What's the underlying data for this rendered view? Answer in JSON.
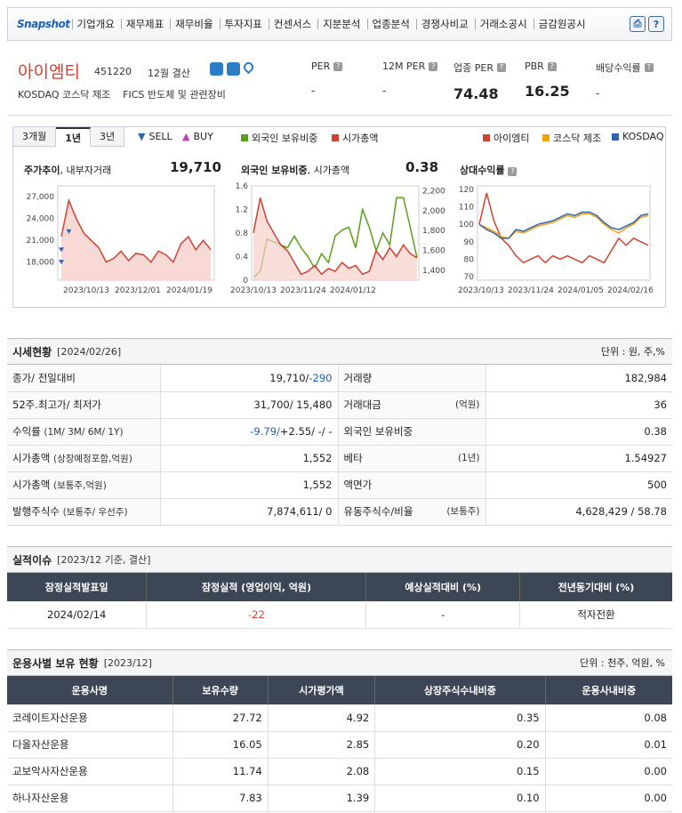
{
  "nav": {
    "snapshot": "Snapshot",
    "items": [
      "기업개요",
      "재무제표",
      "재무비율",
      "투자지표",
      "컨센서스",
      "지분분석",
      "업종분석",
      "경쟁사비교",
      "거래소공시",
      "금감원공시"
    ]
  },
  "company": {
    "name": "아이엠티",
    "code": "451220",
    "fiscal": "12월 결산",
    "market": "KOSDAQ  코스닥 제조",
    "fics": "FICS 반도체 및 관련장비"
  },
  "metrics": [
    {
      "label": "PER",
      "value": "-"
    },
    {
      "label": "12M PER",
      "value": "-"
    },
    {
      "label": "업종 PER",
      "value": "74.48"
    },
    {
      "label": "PBR",
      "value": "16.25"
    },
    {
      "label": "배당수익률",
      "value": "-"
    }
  ],
  "chart_tabs": [
    "3개월",
    "1년",
    "3년"
  ],
  "chart_legend": {
    "sell": "SELL",
    "buy": "BUY",
    "foreign": "외국인 보유비중",
    "mcap": "시가총액",
    "company": "아이엠티",
    "kosdaq_mfg": "코스닥 제조",
    "kosdaq": "KOSDAQ"
  },
  "chart_data": [
    {
      "type": "area",
      "title": "주가추이",
      "subtitle": ", 내부자거래",
      "value": "19,710",
      "x_labels": [
        "2023/10/13",
        "2023/12/01",
        "2024/01/19"
      ],
      "y_ticks": [
        "27,000",
        "24,000",
        "21,000",
        "18,000"
      ],
      "ylim": [
        15500,
        28500
      ],
      "values": [
        21500,
        26500,
        24000,
        22000,
        21000,
        20000,
        18000,
        18500,
        19500,
        18200,
        19200,
        19000,
        18000,
        19500,
        19000,
        18000,
        20500,
        21500,
        19700,
        21000,
        19710
      ],
      "color": "#d2402f"
    },
    {
      "type": "line",
      "title": "외국인 보유비중",
      "subtitle": ", 시가총액",
      "value": "0.38",
      "x_labels": [
        "2023/10/13",
        "2023/11/24",
        "2024/01/12"
      ],
      "y_ticks_left": [
        "1.6",
        "1.2",
        "0.8",
        "0.4",
        "0"
      ],
      "y_ticks_right": [
        "2,200",
        "2,000",
        "1,800",
        "1,600",
        "1,400"
      ],
      "ylim": [
        0,
        1.6
      ],
      "ylim_right": [
        1300,
        2250
      ],
      "series": [
        {
          "name": "외국인 보유비중",
          "color": "#56a01a",
          "values": [
            0.05,
            0.15,
            0.7,
            0.65,
            0.6,
            0.55,
            0.75,
            0.55,
            0.4,
            0.2,
            0.45,
            0.3,
            0.75,
            0.85,
            0.9,
            0.55,
            1.2,
            0.9,
            0.5,
            0.8,
            0.6,
            1.4,
            1.4,
            0.9,
            0.38
          ]
        },
        {
          "name": "시가총액",
          "color": "#d2402f",
          "area": true,
          "values": [
            0.8,
            1.4,
            1.0,
            0.8,
            0.6,
            0.5,
            0.3,
            0.1,
            0.15,
            0.25,
            0.1,
            0.2,
            0.15,
            0.3,
            0.2,
            0.25,
            0.1,
            0.15,
            0.5,
            0.35,
            0.55,
            0.4,
            0.6,
            0.45,
            0.38
          ]
        }
      ]
    },
    {
      "type": "line",
      "title": "상대수익률",
      "subtitle": "",
      "value": "",
      "x_labels": [
        "2023/10/13",
        "2023/11/24",
        "2024/01/05",
        "2024/02/16"
      ],
      "y_ticks": [
        "120",
        "110",
        "100",
        "90",
        "80",
        "70"
      ],
      "ylim": [
        68,
        122
      ],
      "series": [
        {
          "name": "아이엠티",
          "color": "#d2402f",
          "values": [
            100,
            118,
            102,
            92,
            88,
            82,
            78,
            80,
            82,
            78,
            82,
            80,
            82,
            80,
            78,
            82,
            80,
            78,
            85,
            92,
            88,
            92,
            90,
            88
          ]
        },
        {
          "name": "코스닥 제조",
          "color": "#f0a30a",
          "values": [
            100,
            98,
            96,
            93,
            92,
            96,
            95,
            97,
            99,
            100,
            101,
            103,
            105,
            104,
            106,
            106,
            104,
            100,
            97,
            95,
            98,
            100,
            104,
            105
          ]
        },
        {
          "name": "KOSDAQ",
          "color": "#2c63b4",
          "values": [
            100,
            97,
            95,
            92,
            92,
            97,
            96,
            98,
            100,
            101,
            102,
            104,
            106,
            105,
            107,
            107,
            105,
            101,
            98,
            97,
            99,
            101,
            105,
            106
          ]
        }
      ]
    }
  ],
  "price": {
    "title": "시세현황",
    "date": "[2024/02/26]",
    "unit": "단위 : 원, 주,%",
    "rows": [
      {
        "l1": "종가/ 전일대비",
        "l1s": "",
        "v1": "19,710/",
        "v1b": "-290",
        "l2": "거래량",
        "l2s": "",
        "v2": "182,984"
      },
      {
        "l1": "52주.최고가/ 최저가",
        "l1s": "",
        "v1": "31,700/ 15,480",
        "v1b": "",
        "l2": "거래대금",
        "l2s": "(억원)",
        "v2": "36"
      },
      {
        "l1": "수익률",
        "l1s": "(1M/ 3M/ 6M/ 1Y)",
        "v1": "-9.79/",
        "v1b": "+2.55/ -/ -",
        "l2": "외국인 보유비중",
        "l2s": "",
        "v2": "0.38"
      },
      {
        "l1": "시가총액",
        "l1s": "(상장예정포함,억원)",
        "v1": "1,552",
        "v1b": "",
        "l2": "베타",
        "l2s": "(1년)",
        "v2": "1.54927"
      },
      {
        "l1": "시가총액",
        "l1s": "(보통주,억원)",
        "v1": "1,552",
        "v1b": "",
        "l2": "액면가",
        "l2s": "",
        "v2": "500"
      },
      {
        "l1": "발행주식수",
        "l1s": "(보통주/ 우선주)",
        "v1": "7,874,611/ 0",
        "v1b": "",
        "l2": "유동주식수/비율",
        "l2s": "(보통주)",
        "v2": "4,628,429 / 58.78"
      }
    ]
  },
  "earn": {
    "title": "실적이슈",
    "sub": "[2023/12 기준, 결산]",
    "headers": [
      "잠정실적발표일",
      "잠정실적 (영업이익, 억원)",
      "예상실적대비 (%)",
      "전년동기대비 (%)"
    ],
    "row": [
      "2024/02/14",
      "-22",
      "-",
      "적자전환"
    ]
  },
  "funds": {
    "title": "운용사별 보유 현황",
    "sub": "[2023/12]",
    "unit": "단위 : 천주, 억원, %",
    "headers": [
      "운용사명",
      "보유수량",
      "시가평가액",
      "상장주식수내비중",
      "운용사내비중"
    ],
    "rows": [
      [
        "코레이트자산운용",
        "27.72",
        "4.92",
        "0.35",
        "0.08"
      ],
      [
        "다올자산운용",
        "16.05",
        "2.85",
        "0.20",
        "0.01"
      ],
      [
        "교보악사자산운용",
        "11.74",
        "2.08",
        "0.15",
        "0.00"
      ],
      [
        "하나자산운용",
        "7.83",
        "1.39",
        "0.10",
        "0.00"
      ]
    ]
  }
}
